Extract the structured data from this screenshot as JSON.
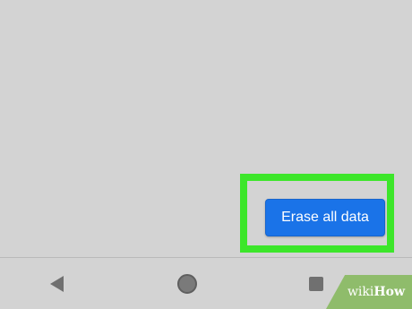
{
  "screen": {
    "erase_button_label": "Erase all data"
  },
  "navigation": {
    "back_icon": "back-triangle-icon",
    "home_icon": "home-circle-icon",
    "recents_icon": "recents-square-icon"
  },
  "watermark": {
    "part1": "wiki",
    "part2": "How"
  },
  "colors": {
    "button": "#1a73e8",
    "highlight": "#3ce62a",
    "nav_icon": "#707070",
    "background": "#d3d3d3"
  }
}
